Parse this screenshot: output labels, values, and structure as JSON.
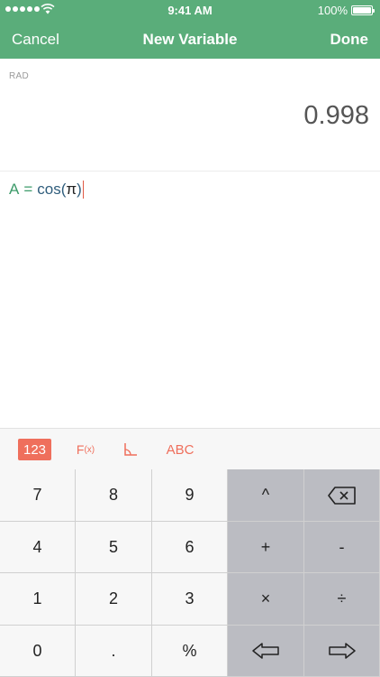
{
  "status_bar": {
    "time": "9:41 AM",
    "battery": "100%",
    "signal_dots": 5,
    "icons": [
      "signal-dots-icon",
      "wifi-icon",
      "battery-icon"
    ]
  },
  "navbar": {
    "cancel": "Cancel",
    "title": "New Variable",
    "done": "Done"
  },
  "display": {
    "mode": "RAD",
    "result": "0.998"
  },
  "expression": {
    "variable": "A",
    "equals": "=",
    "function": "cos",
    "open_paren": "(",
    "argument": "π",
    "close_paren": ")"
  },
  "keyboard_toolbar": {
    "tab_123": "123",
    "tab_fx_main": "F",
    "tab_fx_sub": "(x)",
    "tab_angle": "angle-icon",
    "tab_abc": "ABC",
    "active_tab": "123"
  },
  "keys": {
    "row1": [
      "7",
      "8",
      "9",
      "^",
      "backspace-icon"
    ],
    "row2": [
      "4",
      "5",
      "6",
      "+",
      "-"
    ],
    "row3": [
      "1",
      "2",
      "3",
      "×",
      "÷"
    ],
    "row4": [
      "0",
      ".",
      "%",
      "arrow-left-icon",
      "arrow-right-icon"
    ]
  },
  "colors": {
    "header": "#5aad7a",
    "accent": "#ef6f5c",
    "variable": "#3d9b6a",
    "function": "#2f5d7c"
  }
}
